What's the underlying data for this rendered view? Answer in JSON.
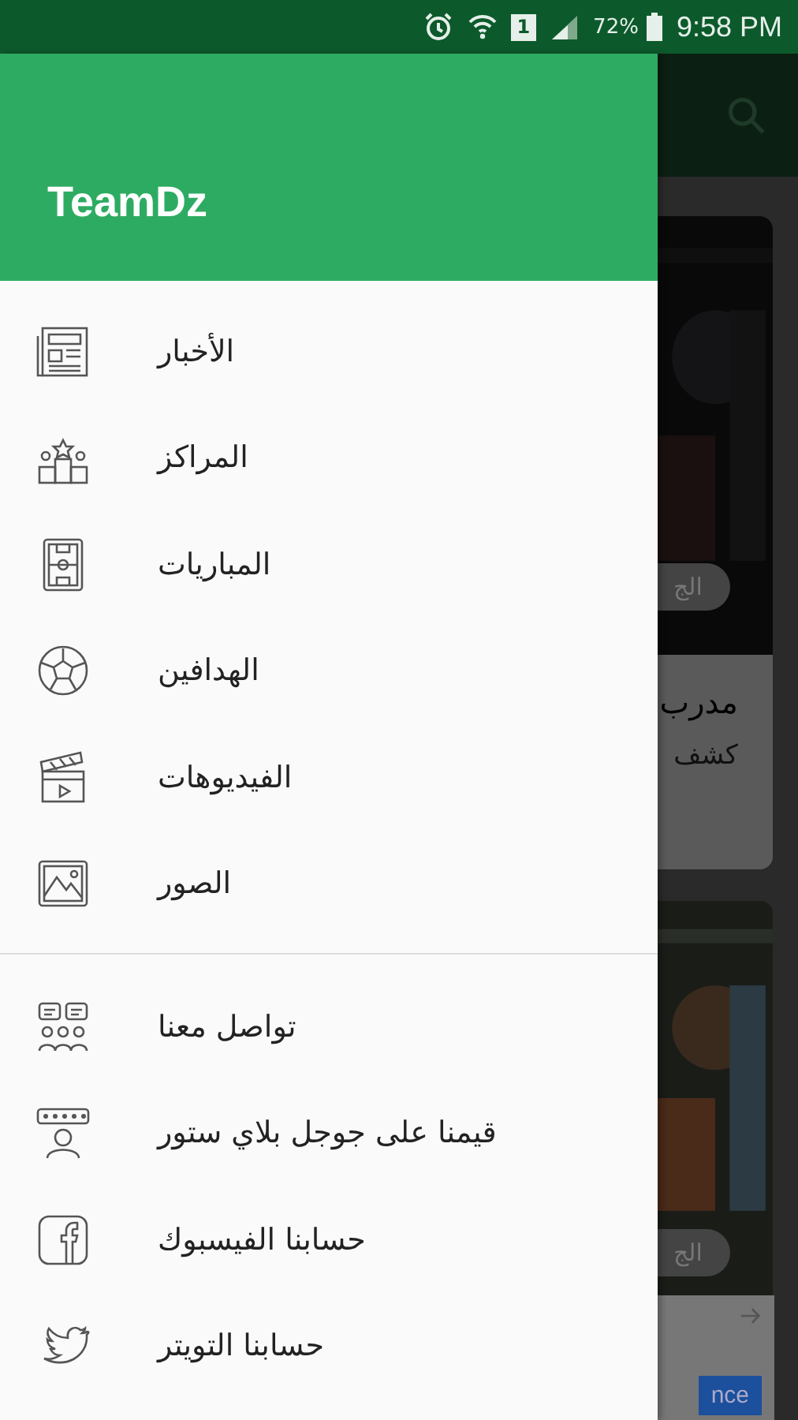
{
  "status_bar": {
    "sim": "1",
    "battery": "72%",
    "time": "9:58 PM"
  },
  "drawer": {
    "title": "TeamDz",
    "sections": [
      {
        "items": [
          {
            "kind": "news",
            "label": "الأخبار"
          },
          {
            "kind": "podium",
            "label": "المراكز"
          },
          {
            "kind": "pitch",
            "label": "المباريات"
          },
          {
            "kind": "ball",
            "label": "الهدافين"
          },
          {
            "kind": "clapper",
            "label": "الفيديوهات"
          },
          {
            "label": "الصور"
          }
        ]
      },
      {
        "items": [
          {
            "kind": "chat",
            "label": "تواصل معنا"
          },
          {
            "kind": "rate",
            "label": "قيمنا على جوجل بلاي ستور"
          },
          {
            "kind": "facebook",
            "label": "حسابنا الفيسبوك"
          },
          {
            "kind": "twitter",
            "label": "حسابنا التويتر"
          }
        ]
      }
    ]
  },
  "behind": {
    "cards": [
      {
        "chip": "الج",
        "title": "مدرب",
        "subtitle": "كشف"
      },
      {
        "chip": "الج"
      }
    ],
    "ad": {
      "button": "nce"
    }
  }
}
